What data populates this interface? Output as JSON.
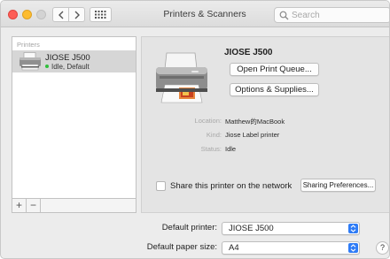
{
  "window": {
    "title": "Printers & Scanners"
  },
  "search": {
    "placeholder": "Search"
  },
  "printer_list": {
    "header": "Printers",
    "items": [
      {
        "name": "JIOSE J500",
        "status": "Idle, Default",
        "status_color": "#2fbf3b"
      }
    ],
    "add_label": "+",
    "remove_label": "−"
  },
  "detail": {
    "printer_name": "JIOSE J500",
    "open_queue_label": "Open Print Queue...",
    "options_label": "Options & Supplies...",
    "location_label": "Location:",
    "location_value": "Matthew的MacBook",
    "kind_label": "Kind:",
    "kind_value": "Jiose Label printer",
    "status_label": "Status:",
    "status_value": "Idle",
    "share_label": "Share this printer on the network",
    "share_checked": false,
    "sharing_prefs_label": "Sharing Preferences..."
  },
  "defaults": {
    "printer_label": "Default printer:",
    "printer_value": "JIOSE J500",
    "paper_label": "Default paper size:",
    "paper_value": "A4"
  },
  "help_label": "?",
  "colors": {
    "accent": "#2f7cf6",
    "selection": "#d6d6d6",
    "close": "#fd5e56",
    "minimize": "#fdbc2f"
  }
}
